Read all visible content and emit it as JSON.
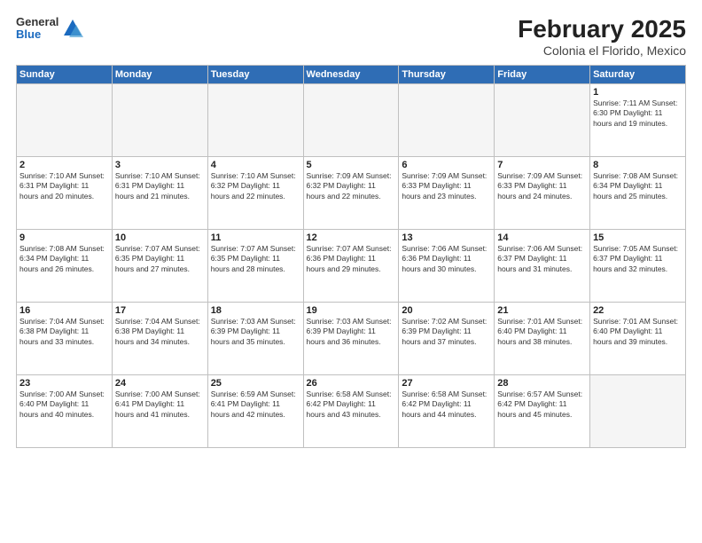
{
  "header": {
    "logo_general": "General",
    "logo_blue": "Blue",
    "title": "February 2025",
    "subtitle": "Colonia el Florido, Mexico"
  },
  "days_of_week": [
    "Sunday",
    "Monday",
    "Tuesday",
    "Wednesday",
    "Thursday",
    "Friday",
    "Saturday"
  ],
  "weeks": [
    [
      {
        "day": "",
        "info": ""
      },
      {
        "day": "",
        "info": ""
      },
      {
        "day": "",
        "info": ""
      },
      {
        "day": "",
        "info": ""
      },
      {
        "day": "",
        "info": ""
      },
      {
        "day": "",
        "info": ""
      },
      {
        "day": "1",
        "info": "Sunrise: 7:11 AM\nSunset: 6:30 PM\nDaylight: 11 hours and 19 minutes."
      }
    ],
    [
      {
        "day": "2",
        "info": "Sunrise: 7:10 AM\nSunset: 6:31 PM\nDaylight: 11 hours and 20 minutes."
      },
      {
        "day": "3",
        "info": "Sunrise: 7:10 AM\nSunset: 6:31 PM\nDaylight: 11 hours and 21 minutes."
      },
      {
        "day": "4",
        "info": "Sunrise: 7:10 AM\nSunset: 6:32 PM\nDaylight: 11 hours and 22 minutes."
      },
      {
        "day": "5",
        "info": "Sunrise: 7:09 AM\nSunset: 6:32 PM\nDaylight: 11 hours and 22 minutes."
      },
      {
        "day": "6",
        "info": "Sunrise: 7:09 AM\nSunset: 6:33 PM\nDaylight: 11 hours and 23 minutes."
      },
      {
        "day": "7",
        "info": "Sunrise: 7:09 AM\nSunset: 6:33 PM\nDaylight: 11 hours and 24 minutes."
      },
      {
        "day": "8",
        "info": "Sunrise: 7:08 AM\nSunset: 6:34 PM\nDaylight: 11 hours and 25 minutes."
      }
    ],
    [
      {
        "day": "9",
        "info": "Sunrise: 7:08 AM\nSunset: 6:34 PM\nDaylight: 11 hours and 26 minutes."
      },
      {
        "day": "10",
        "info": "Sunrise: 7:07 AM\nSunset: 6:35 PM\nDaylight: 11 hours and 27 minutes."
      },
      {
        "day": "11",
        "info": "Sunrise: 7:07 AM\nSunset: 6:35 PM\nDaylight: 11 hours and 28 minutes."
      },
      {
        "day": "12",
        "info": "Sunrise: 7:07 AM\nSunset: 6:36 PM\nDaylight: 11 hours and 29 minutes."
      },
      {
        "day": "13",
        "info": "Sunrise: 7:06 AM\nSunset: 6:36 PM\nDaylight: 11 hours and 30 minutes."
      },
      {
        "day": "14",
        "info": "Sunrise: 7:06 AM\nSunset: 6:37 PM\nDaylight: 11 hours and 31 minutes."
      },
      {
        "day": "15",
        "info": "Sunrise: 7:05 AM\nSunset: 6:37 PM\nDaylight: 11 hours and 32 minutes."
      }
    ],
    [
      {
        "day": "16",
        "info": "Sunrise: 7:04 AM\nSunset: 6:38 PM\nDaylight: 11 hours and 33 minutes."
      },
      {
        "day": "17",
        "info": "Sunrise: 7:04 AM\nSunset: 6:38 PM\nDaylight: 11 hours and 34 minutes."
      },
      {
        "day": "18",
        "info": "Sunrise: 7:03 AM\nSunset: 6:39 PM\nDaylight: 11 hours and 35 minutes."
      },
      {
        "day": "19",
        "info": "Sunrise: 7:03 AM\nSunset: 6:39 PM\nDaylight: 11 hours and 36 minutes."
      },
      {
        "day": "20",
        "info": "Sunrise: 7:02 AM\nSunset: 6:39 PM\nDaylight: 11 hours and 37 minutes."
      },
      {
        "day": "21",
        "info": "Sunrise: 7:01 AM\nSunset: 6:40 PM\nDaylight: 11 hours and 38 minutes."
      },
      {
        "day": "22",
        "info": "Sunrise: 7:01 AM\nSunset: 6:40 PM\nDaylight: 11 hours and 39 minutes."
      }
    ],
    [
      {
        "day": "23",
        "info": "Sunrise: 7:00 AM\nSunset: 6:40 PM\nDaylight: 11 hours and 40 minutes."
      },
      {
        "day": "24",
        "info": "Sunrise: 7:00 AM\nSunset: 6:41 PM\nDaylight: 11 hours and 41 minutes."
      },
      {
        "day": "25",
        "info": "Sunrise: 6:59 AM\nSunset: 6:41 PM\nDaylight: 11 hours and 42 minutes."
      },
      {
        "day": "26",
        "info": "Sunrise: 6:58 AM\nSunset: 6:42 PM\nDaylight: 11 hours and 43 minutes."
      },
      {
        "day": "27",
        "info": "Sunrise: 6:58 AM\nSunset: 6:42 PM\nDaylight: 11 hours and 44 minutes."
      },
      {
        "day": "28",
        "info": "Sunrise: 6:57 AM\nSunset: 6:42 PM\nDaylight: 11 hours and 45 minutes."
      },
      {
        "day": "",
        "info": ""
      }
    ]
  ]
}
